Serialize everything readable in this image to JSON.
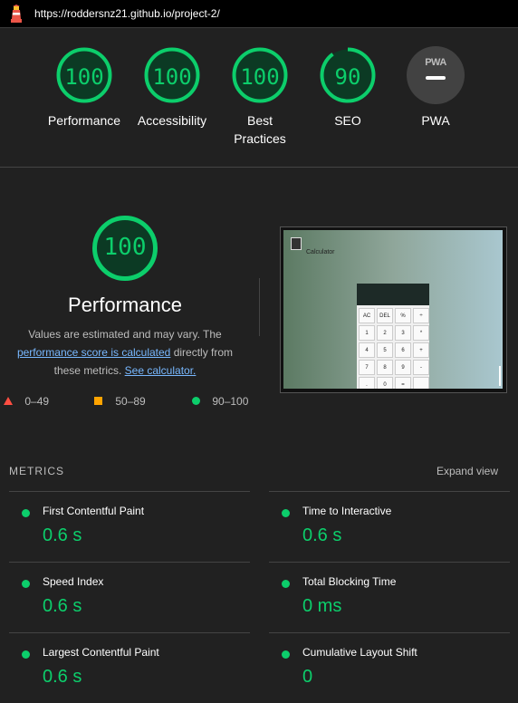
{
  "header": {
    "url": "https://roddersnz21.github.io/project-2/"
  },
  "gauges": [
    {
      "score": "100",
      "label": "Performance"
    },
    {
      "score": "100",
      "label": "Accessibility"
    },
    {
      "score": "100",
      "label": "Best Practices"
    },
    {
      "score": "90",
      "label": "SEO"
    },
    {
      "score": "PWA",
      "label": "PWA"
    }
  ],
  "performance": {
    "score": "100",
    "title": "Performance",
    "note_part1": "Values are estimated and may vary. The ",
    "note_link1": "performance score is calculated",
    "note_part2": " directly from these metrics. ",
    "note_link2": "See calculator."
  },
  "legend": {
    "fail": "0–49",
    "average": "50–89",
    "pass": "90–100"
  },
  "screenshot": {
    "title": "Calculator",
    "keys": [
      "AC",
      "DEL",
      "%",
      "÷",
      "1",
      "2",
      "3",
      "*",
      "4",
      "5",
      "6",
      "+",
      "7",
      "8",
      "9",
      "-",
      ".",
      "0",
      "=",
      ""
    ]
  },
  "metrics": {
    "heading": "METRICS",
    "expand": "Expand view",
    "items": [
      {
        "label": "First Contentful Paint",
        "value": "0.6 s"
      },
      {
        "label": "Time to Interactive",
        "value": "0.6 s"
      },
      {
        "label": "Speed Index",
        "value": "0.6 s"
      },
      {
        "label": "Total Blocking Time",
        "value": "0 ms"
      },
      {
        "label": "Largest Contentful Paint",
        "value": "0.6 s"
      },
      {
        "label": "Cumulative Layout Shift",
        "value": "0"
      }
    ]
  },
  "colors": {
    "pass": "#0cce6b",
    "average": "#ffa400",
    "fail": "#ff4e42",
    "background": "#212121"
  }
}
